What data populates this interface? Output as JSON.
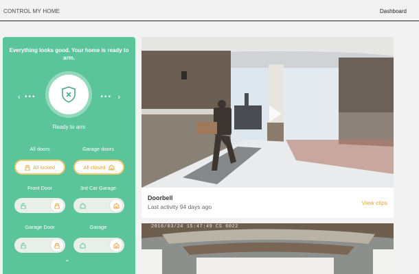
{
  "header": {
    "app_title": "CONTROL MY HOME",
    "nav_dashboard": "Dashboard"
  },
  "security": {
    "status_message": "Everything looks good. Your home is ready to arm.",
    "arm_label": "Ready to arm",
    "shield_icon": "shield-x-icon"
  },
  "groups": {
    "all_doors": {
      "label": "All doors",
      "status": "All locked",
      "icon": "lock-icon"
    },
    "garage_doors": {
      "label": "Garage doors",
      "status": "All closed",
      "icon": "garage-icon"
    }
  },
  "devices": [
    {
      "label": "Front Door",
      "icon_off": "unlock-icon",
      "icon_on": "lock-icon"
    },
    {
      "label": "3rd Car Garage",
      "icon_off": "garage-open-icon",
      "icon_on": "garage-icon"
    },
    {
      "label": "Garage Door",
      "icon_off": "unlock-icon",
      "icon_on": "lock-icon"
    },
    {
      "label": "Garage",
      "icon_off": "garage-open-icon",
      "icon_on": "garage-icon"
    }
  ],
  "cameras": [
    {
      "name": "Doorbell",
      "activity": "Last activity 94 days ago",
      "action": "View clips"
    },
    {
      "timestamp": "2016/03/24 15:47:49 CS 6022"
    }
  ],
  "colors": {
    "panel": "#5bc49b",
    "accent": "#e9a23b",
    "accent_border": "#f2c96b"
  }
}
